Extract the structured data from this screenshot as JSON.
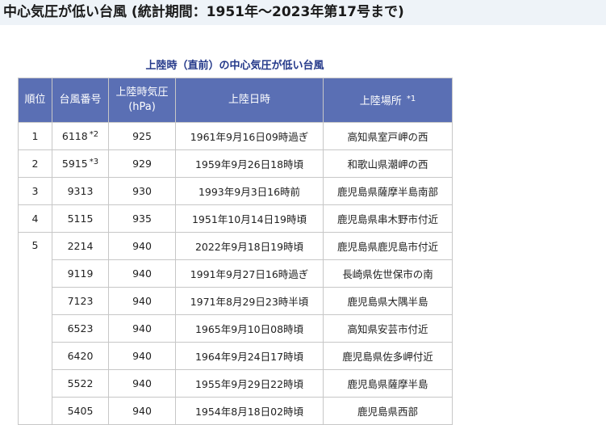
{
  "page": {
    "heading": "中心気圧が低い台風 (統計期間：1951年～2023年第17号まで)"
  },
  "table": {
    "caption": "上陸時（直前）の中心気圧が低い台風",
    "headers": {
      "rank": "順位",
      "typhoon_number": "台風番号",
      "pressure_line1": "上陸時気圧",
      "pressure_line2": "(hPa)",
      "datetime": "上陸日時",
      "place": "上陸場所",
      "place_note": "*1"
    },
    "rows": [
      {
        "rank": "1",
        "number": "6118",
        "note": "*2",
        "pressure": "925",
        "datetime": "1961年9月16日09時過ぎ",
        "place": "高知県室戸岬の西"
      },
      {
        "rank": "2",
        "number": "5915",
        "note": "*3",
        "pressure": "929",
        "datetime": "1959年9月26日18時頃",
        "place": "和歌山県潮岬の西"
      },
      {
        "rank": "3",
        "number": "9313",
        "note": "",
        "pressure": "930",
        "datetime": "1993年9月3日16時前",
        "place": "鹿児島県薩摩半島南部"
      },
      {
        "rank": "4",
        "number": "5115",
        "note": "",
        "pressure": "935",
        "datetime": "1951年10月14日19時頃",
        "place": "鹿児島県串木野市付近"
      },
      {
        "rank": "5",
        "number": "2214",
        "note": "",
        "pressure": "940",
        "datetime": "2022年9月18日19時頃",
        "place": "鹿児島県鹿児島市付近"
      },
      {
        "rank": "",
        "number": "9119",
        "note": "",
        "pressure": "940",
        "datetime": "1991年9月27日16時過ぎ",
        "place": "長崎県佐世保市の南"
      },
      {
        "rank": "",
        "number": "7123",
        "note": "",
        "pressure": "940",
        "datetime": "1971年8月29日23時半頃",
        "place": "鹿児島県大隅半島"
      },
      {
        "rank": "",
        "number": "6523",
        "note": "",
        "pressure": "940",
        "datetime": "1965年9月10日08時頃",
        "place": "高知県安芸市付近"
      },
      {
        "rank": "",
        "number": "6420",
        "note": "",
        "pressure": "940",
        "datetime": "1964年9月24日17時頃",
        "place": "鹿児島県佐多岬付近"
      },
      {
        "rank": "",
        "number": "5522",
        "note": "",
        "pressure": "940",
        "datetime": "1955年9月29日22時頃",
        "place": "鹿児島県薩摩半島"
      },
      {
        "rank": "",
        "number": "5405",
        "note": "",
        "pressure": "940",
        "datetime": "1954年8月18日02時頃",
        "place": "鹿児島県西部"
      }
    ]
  }
}
